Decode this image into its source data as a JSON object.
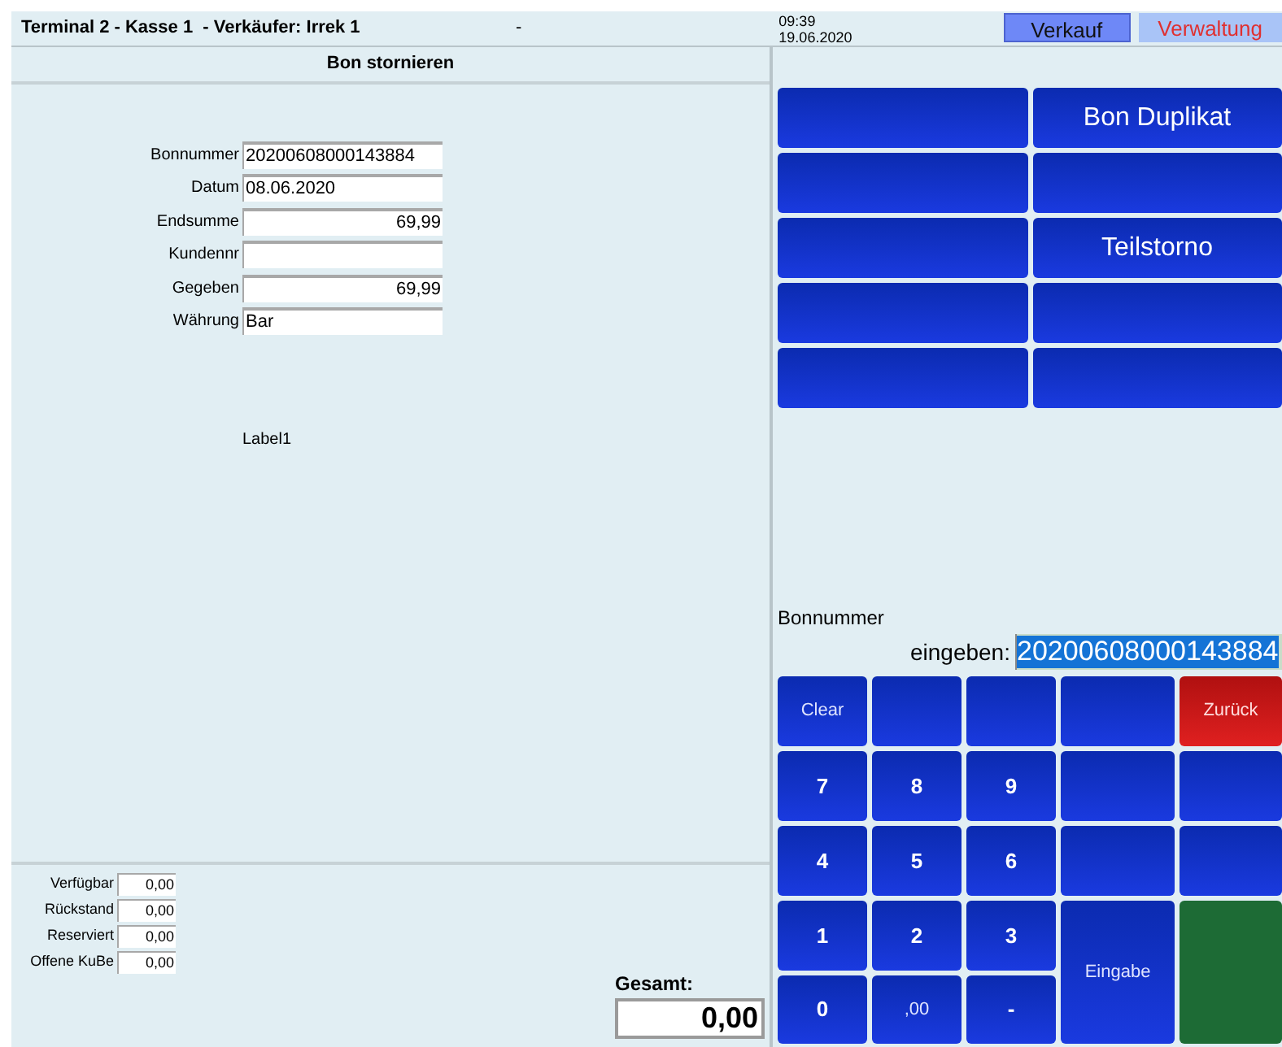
{
  "header": {
    "title": "Terminal 2 - Kasse 1  - Verkäufer: Irrek 1",
    "separator": "-",
    "time": "09:39",
    "date": "19.06.2020",
    "tabs": [
      {
        "label": "Verkauf",
        "selected": true
      },
      {
        "label": "Verwaltung",
        "selected": false
      }
    ]
  },
  "panel": {
    "title": "Bon stornieren",
    "fields": [
      {
        "label": "Bonnummer",
        "value": "20200608000143884",
        "kind": "text"
      },
      {
        "label": "Datum",
        "value": "08.06.2020",
        "kind": "text"
      },
      {
        "label": "Endsumme",
        "value": "69,99",
        "kind": "amount"
      },
      {
        "label": "Kundennr",
        "kind": "text"
      },
      {
        "label": "Gegeben",
        "value": "69,99",
        "kind": "amount"
      },
      {
        "label": "Währung",
        "value": "Bar",
        "kind": "text"
      }
    ],
    "note": "Label1"
  },
  "balances": [
    {
      "label": "Verfügbar",
      "value": "0,00"
    },
    {
      "label": "Rückstand",
      "value": "0,00"
    },
    {
      "label": "Reserviert",
      "value": "0,00"
    },
    {
      "label": "Offene KuBe",
      "value": "0,00"
    }
  ],
  "total": {
    "label": "Gesamt:",
    "value": "0,00"
  },
  "function_buttons": [
    {
      "kind": "blank"
    },
    {
      "kind": "labeled",
      "label": "Bon Duplikat"
    },
    {
      "kind": "blank"
    },
    {
      "kind": "blank"
    },
    {
      "kind": "blank"
    },
    {
      "kind": "labeled",
      "label": "Teilstorno"
    },
    {
      "kind": "blank"
    },
    {
      "kind": "blank"
    },
    {
      "kind": "blank"
    },
    {
      "kind": "blank"
    }
  ],
  "entry": {
    "title": "Bonnummer",
    "label": "eingeben:",
    "value": "20200608000143884"
  },
  "keypad": [
    {
      "label": "Clear",
      "kind": "key",
      "tall": false
    },
    {
      "kind": "key",
      "tall": false
    },
    {
      "kind": "key",
      "tall": false
    },
    {
      "kind": "key",
      "tall": false
    },
    {
      "label": "Zurück",
      "kind": "danger",
      "tall": false
    },
    {
      "label": "7",
      "kind": "digit",
      "tall": false
    },
    {
      "label": "8",
      "kind": "digit",
      "tall": false
    },
    {
      "label": "9",
      "kind": "digit",
      "tall": false
    },
    {
      "kind": "key",
      "tall": false
    },
    {
      "kind": "key",
      "tall": false
    },
    {
      "label": "4",
      "kind": "digit",
      "tall": false
    },
    {
      "label": "5",
      "kind": "digit",
      "tall": false
    },
    {
      "label": "6",
      "kind": "digit",
      "tall": false
    },
    {
      "kind": "key",
      "tall": false
    },
    {
      "kind": "key",
      "tall": false
    },
    {
      "label": "1",
      "kind": "digit",
      "tall": false
    },
    {
      "label": "2",
      "kind": "digit",
      "tall": false
    },
    {
      "label": "3",
      "kind": "digit",
      "tall": false
    },
    {
      "label": "Eingabe",
      "kind": "key",
      "tall": true
    },
    {
      "kind": "confirm",
      "tall": true
    },
    {
      "label": "0",
      "kind": "digit",
      "tall": false
    },
    {
      "label": ",00",
      "kind": "key",
      "tall": false
    },
    {
      "label": "-",
      "kind": "digit",
      "tall": false
    }
  ]
}
